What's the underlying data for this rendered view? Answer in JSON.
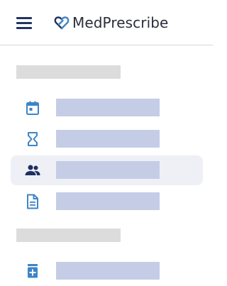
{
  "header": {
    "menu_icon": "hamburger-menu-icon",
    "logo_icon": "heart-link-logo-icon",
    "logo_text": "MedPrescribe"
  },
  "sidebar": {
    "sections": [
      {
        "label": "",
        "items": [
          {
            "icon": "calendar-icon",
            "label": "",
            "active": false
          },
          {
            "icon": "hourglass-icon",
            "label": "",
            "active": false
          },
          {
            "icon": "people-icon",
            "label": "",
            "active": true
          },
          {
            "icon": "document-icon",
            "label": "",
            "active": false
          }
        ]
      },
      {
        "label": "",
        "items": [
          {
            "icon": "medicine-bottle-icon",
            "label": "",
            "active": false
          }
        ]
      }
    ]
  },
  "colors": {
    "icon_blue": "#3d85c6",
    "active_icon": "#1f2f63",
    "placeholder_label": "#c5cde6",
    "placeholder_section": "#dcdcdc",
    "active_bg": "#eef0f5",
    "logo_text": "#2a2d3a"
  }
}
